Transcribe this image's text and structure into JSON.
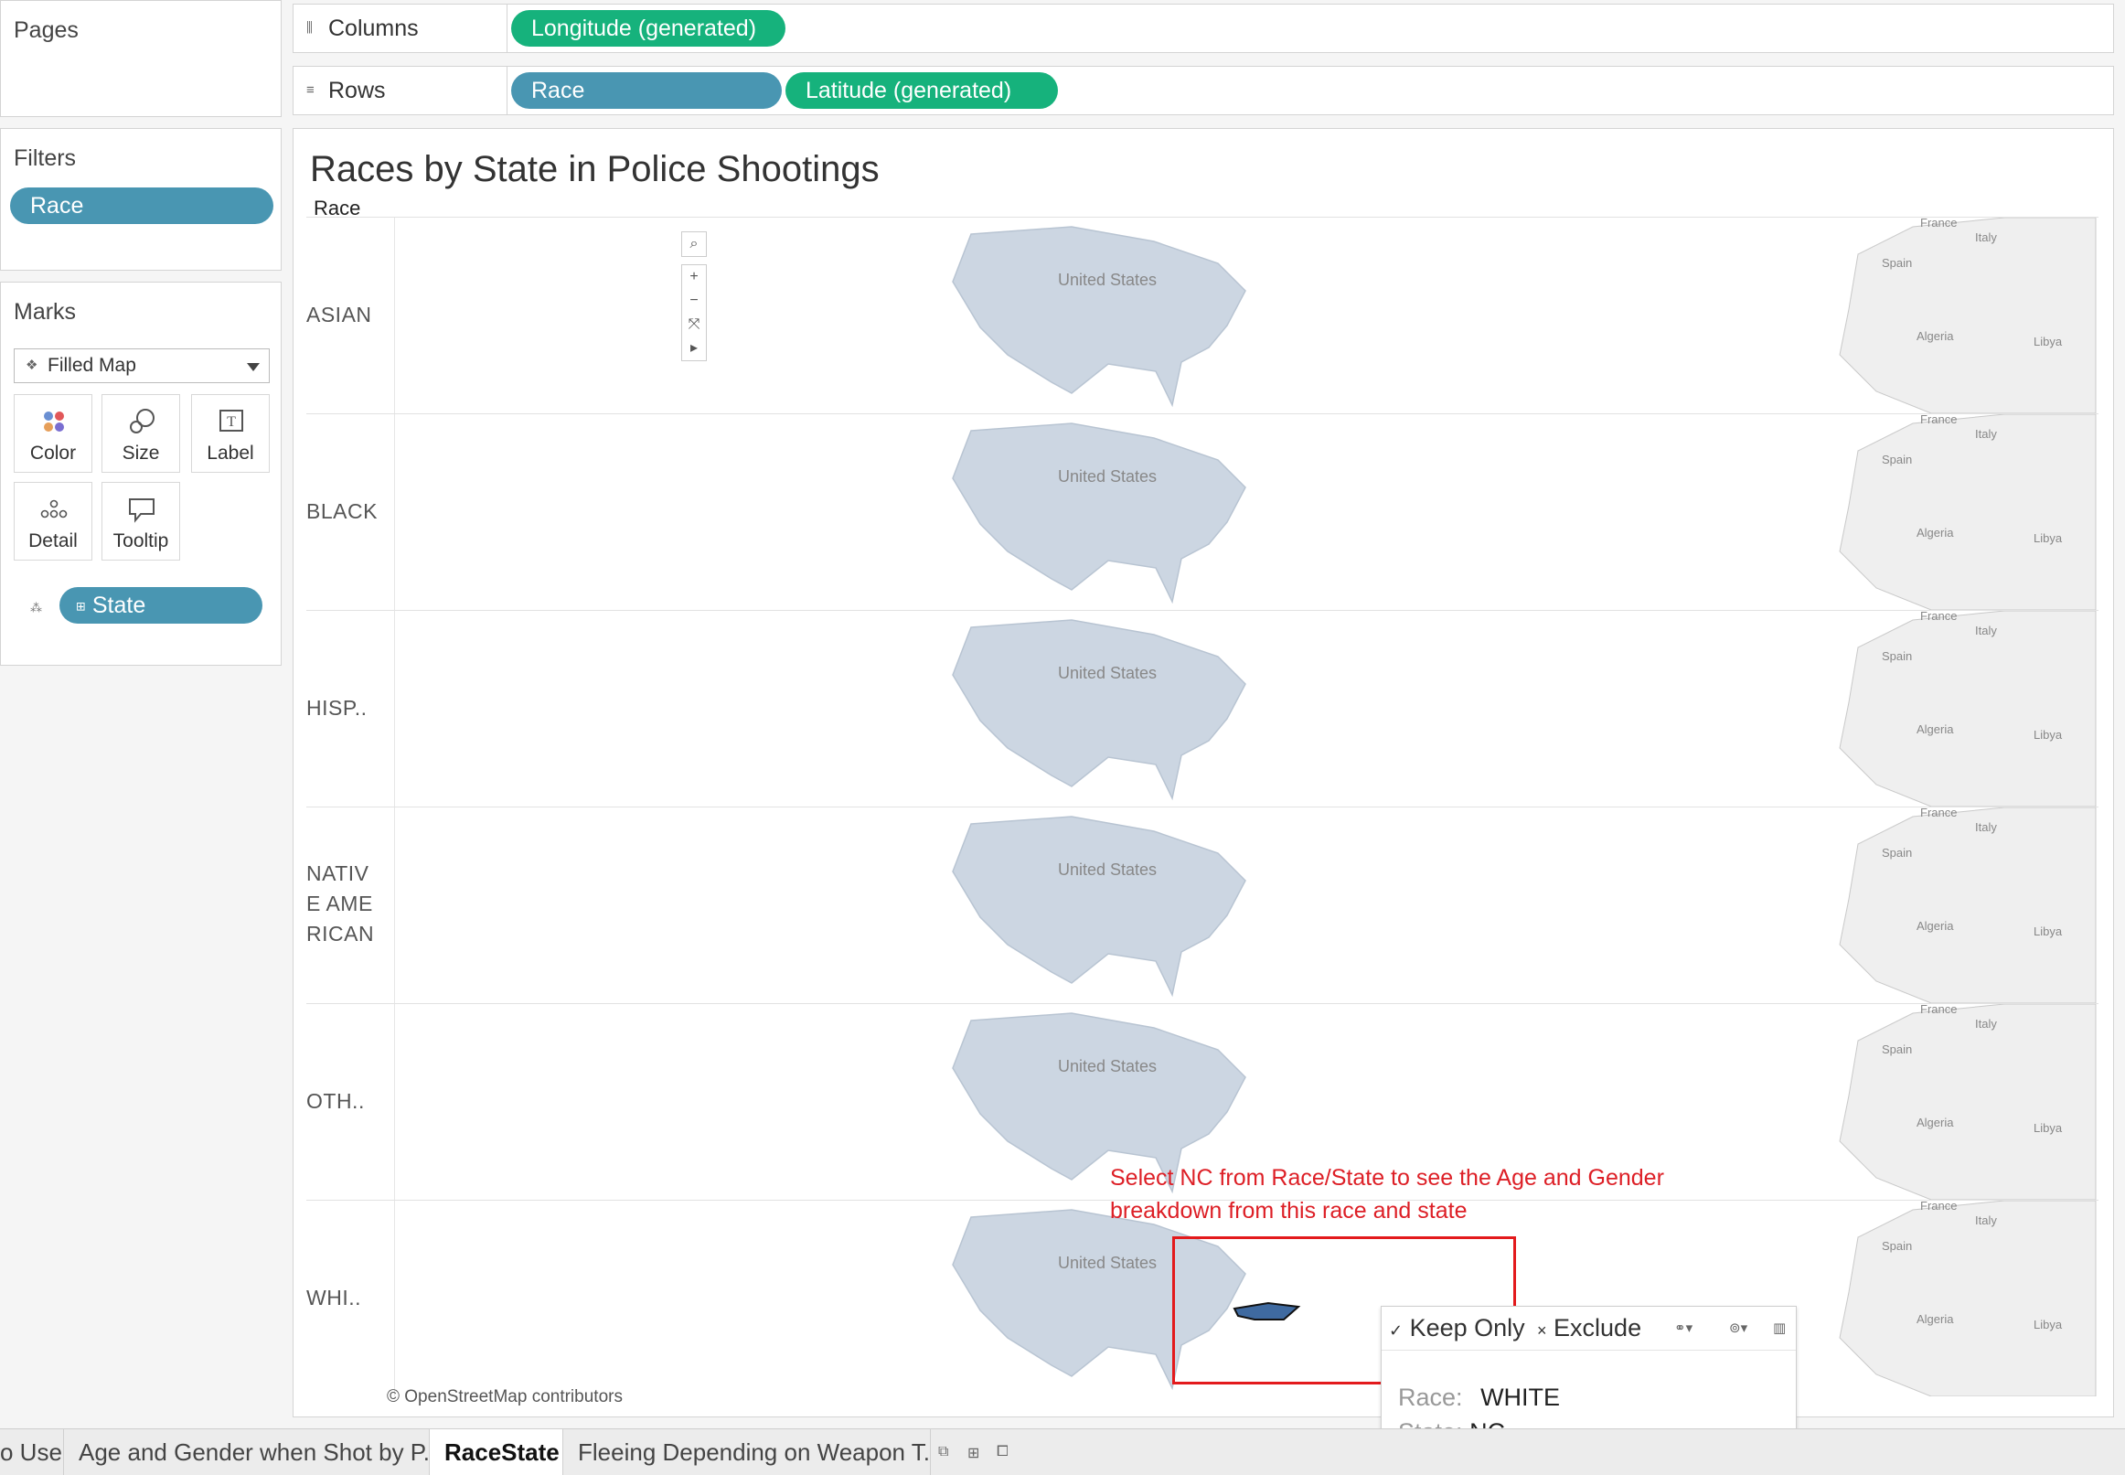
{
  "pages": {
    "title": "Pages"
  },
  "filters": {
    "title": "Filters",
    "pills": [
      "Race"
    ]
  },
  "marks": {
    "title": "Marks",
    "mark_type": "Filled Map",
    "buttons": {
      "color": "Color",
      "size": "Size",
      "label": "Label",
      "detail": "Detail",
      "tooltip": "Tooltip"
    },
    "detail_pill": "State"
  },
  "shelves": {
    "columns": {
      "label": "Columns",
      "pills": [
        "Longitude (generated)"
      ]
    },
    "rows": {
      "label": "Rows",
      "pills": [
        "Race",
        "Latitude (generated)"
      ]
    }
  },
  "viz": {
    "title": "Races by State in Police Shootings",
    "row_header": "Race",
    "rows": [
      {
        "label": "ASIAN",
        "country_label": "United States"
      },
      {
        "label": "BLACK",
        "country_label": "United States"
      },
      {
        "label": "HISP..",
        "country_label": "United States"
      },
      {
        "label": "NATIVE AMERICAN",
        "label_lines": [
          "NATIV",
          "E AME",
          "RICAN"
        ],
        "country_label": "United States"
      },
      {
        "label": "OTH..",
        "country_label": "United States"
      },
      {
        "label": "WHI..",
        "country_label": "United States"
      }
    ],
    "europe_labels": {
      "france": "France",
      "italy": "Italy",
      "spain": "Spain",
      "algeria": "Algeria",
      "libya": "Libya"
    },
    "credit": "© OpenStreetMap contributors",
    "colors": {
      "state_fill": "#ccd6e2",
      "selected_state": "#3f6aa0",
      "annotation": "#dd1f26"
    }
  },
  "annotation": {
    "line1": "Select NC from Race/State to see the Age and Gender",
    "line2": "breakdown from this race and state"
  },
  "tooltip": {
    "keep_only": "Keep Only",
    "exclude": "Exclude",
    "race_key": "Race:",
    "race_value": "WHITE",
    "state_key": "State:",
    "state_value": "NC"
  },
  "tabs": [
    "o Use",
    "Age and Gender when Shot by P...",
    "RaceState",
    "Fleeing Depending on Weapon T..."
  ]
}
